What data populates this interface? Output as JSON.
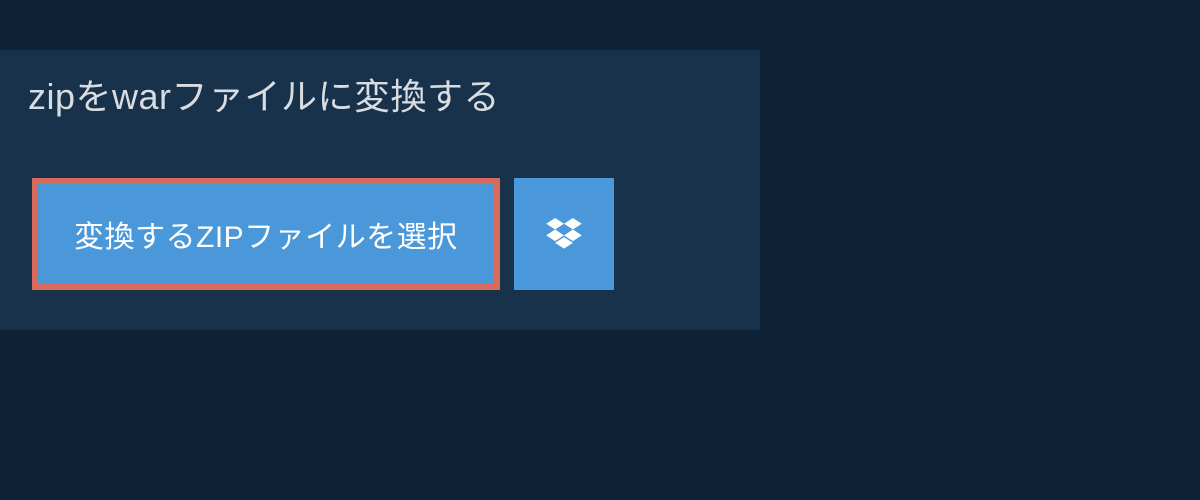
{
  "header": {
    "title": "zipをwarファイルに変換する"
  },
  "actions": {
    "select_file_label": "変換するZIPファイルを選択"
  }
}
